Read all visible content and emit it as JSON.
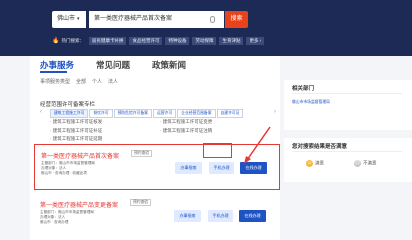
{
  "search": {
    "city": "佛山市",
    "query": "第一类医疗器械产品首次备案",
    "button": "搜索"
  },
  "hot": {
    "label": "热门搜索：",
    "tags": [
      "居民健康卡补换",
      "食品经营许可",
      "特种设备",
      "劳动保障",
      "生育津贴",
      "更多 ›"
    ]
  },
  "tabs": [
    "办事服务",
    "常见问题",
    "政策新闻"
  ],
  "filters": [
    "事项服务类型",
    "全部",
    "个人",
    "法人"
  ],
  "section_title": "经营范围许可备案专栏",
  "guide_tabs": [
    "建筑工程施工许可",
    "餐饮许可",
    "预防危险许可备案",
    "运营许可",
    "企业经营范围备案",
    "自建许可证"
  ],
  "links_left": [
    "· 建筑工程施工许可证核发",
    "· 建筑工程施工许可证补证",
    "· 建筑工程施工许可证延期"
  ],
  "links_right": [
    "· 建筑工程施工许可证变更",
    "· 建筑工程施工许可证注销"
  ],
  "card1": {
    "title": "第一类医疗器械产品首次备案",
    "tag": "预约查验",
    "meta": [
      "主管部门：佛山市市场监督管理局",
      "办理对象：法人",
      "佛山市 · 查询办理 · 收藏此项"
    ],
    "btn_guide": "办事指南",
    "btn_app": "手机办理",
    "btn_online": "在线办理"
  },
  "card2": {
    "title": "第一类医疗器械产品变更备案",
    "tag": "预约查验",
    "meta": [
      "主管部门：佛山市市场监督管理局",
      "办理对象：法人",
      "佛山市 · 查询办理"
    ],
    "btn_guide": "办事指南",
    "btn_app": "手机办理",
    "btn_online": "在线办理"
  },
  "side": {
    "dept_title": "相关部门",
    "dept": "佛山市市场监督管理局",
    "feedback_title": "您对搜索结果是否满意",
    "satisfied": "满意",
    "unsatisfied": "不满意"
  },
  "colors": {
    "header": "#1d2a55",
    "accent": "#1e53c3",
    "search_button": "#e8431b",
    "highlight": "#e53935"
  }
}
